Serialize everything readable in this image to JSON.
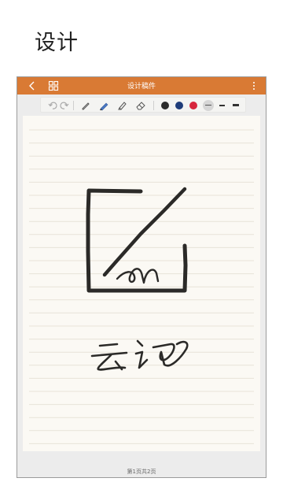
{
  "heading": "设计",
  "app": {
    "title": "设计稿件",
    "page_indicator": "第1页共2页"
  },
  "icons": {
    "back": "chevron-left-icon",
    "grid": "grid-view-icon",
    "more": "more-vertical-icon",
    "undo": "undo-icon",
    "redo": "redo-icon",
    "pencil": "pencil-icon",
    "pen": "pen-icon",
    "marker": "marker-icon",
    "eraser": "eraser-icon"
  },
  "colors": {
    "accent": "#d97a34",
    "paper": "#fbf9f4",
    "ink": "#2b2a28",
    "black_swatch": "#2b2b2b",
    "navy_swatch": "#1f3d7a",
    "red_swatch": "#d7263d"
  },
  "handwriting": {
    "text": "云记"
  }
}
